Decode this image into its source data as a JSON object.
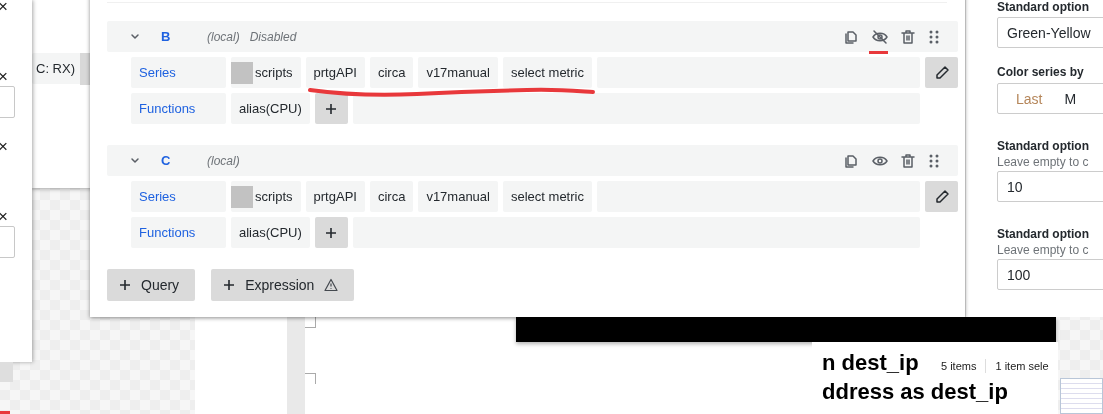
{
  "left_panel": {
    "close_marks": [
      "×",
      "×",
      "×",
      "×"
    ]
  },
  "background_window": {
    "chip": "C: RX)"
  },
  "queries": [
    {
      "letter": "B",
      "datasource": "(local)",
      "status": "Disabled",
      "hidden": true,
      "series_label": "Series",
      "series": [
        "scripts",
        "prtgAPI",
        "circa",
        "v17manual",
        "select metric"
      ],
      "functions_label": "Functions",
      "functions": [
        "alias(CPU)"
      ]
    },
    {
      "letter": "C",
      "datasource": "(local)",
      "hidden": false,
      "series_label": "Series",
      "series": [
        "scripts",
        "prtgAPI",
        "circa",
        "v17manual",
        "select metric"
      ],
      "functions_label": "Functions",
      "functions": [
        "alias(CPU)"
      ]
    }
  ],
  "add_buttons": [
    {
      "label": "Query",
      "warning": false
    },
    {
      "label": "Expression",
      "warning": true
    }
  ],
  "options_panel": {
    "color_scheme_label": "Standard option",
    "color_scheme": "Green-Yellow",
    "color_by_label": "Color series by",
    "color_by": [
      {
        "label": "Last",
        "selected": true
      },
      {
        "label": "M",
        "selected": false
      }
    ],
    "fields": [
      {
        "label": "Standard option",
        "hint": "Leave empty to c",
        "value": "10"
      },
      {
        "label": "Standard option",
        "hint": "Leave empty to c",
        "value": "100"
      }
    ]
  },
  "document": {
    "lines": [
      "n dest_ip",
      "ddress as dest_ip"
    ]
  },
  "status_bar": {
    "items": "5 items",
    "selection": "1 item sele"
  }
}
